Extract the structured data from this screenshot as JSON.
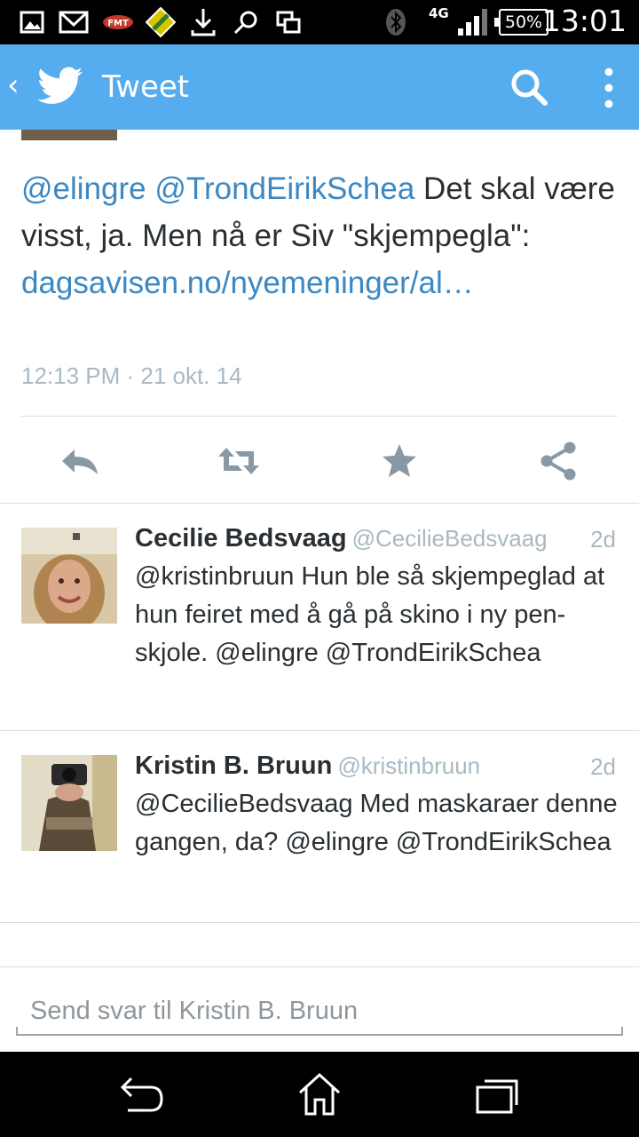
{
  "status_bar": {
    "time": "13:01",
    "battery": "50%",
    "network": "4G",
    "colors": {
      "background": "#000000",
      "icon": "#ffffff"
    }
  },
  "app_bar": {
    "title": "Tweet",
    "color": "#55acee"
  },
  "main_tweet": {
    "mention1": "@elingre",
    "mention2": "@TrondEirikSchea",
    "text": " Det skal være visst, ja. Men nå er Siv \"skjempegla\": ",
    "link": "dagsavisen.no/nyemeninger/al…",
    "timestamp": "12:13 PM · 21 okt. 14"
  },
  "actions": {
    "reply": "reply-icon",
    "retweet": "retweet-icon",
    "favorite": "star-icon",
    "share": "share-icon",
    "color": "#8899a6"
  },
  "replies": [
    {
      "name": "Cecilie Bedsvaag",
      "handle": "@CecilieBedsvaag",
      "time": "2d",
      "text": "@kristinbruun Hun ble så skjempeglad at hun feiret med å gå på skino i ny pen-skjole. @elingre @TrondEirikSchea"
    },
    {
      "name": "Kristin B. Bruun",
      "handle": "@kristinbruun",
      "time": "2d",
      "text": "@CecilieBedsvaag Med maskaraer denne gangen,  da?  @elingre @TrondEirikSchea"
    }
  ],
  "composer": {
    "placeholder": "Send svar til Kristin B. Bruun"
  },
  "nav_bar": {
    "back": "back-icon",
    "home": "home-icon",
    "recents": "recents-icon"
  }
}
